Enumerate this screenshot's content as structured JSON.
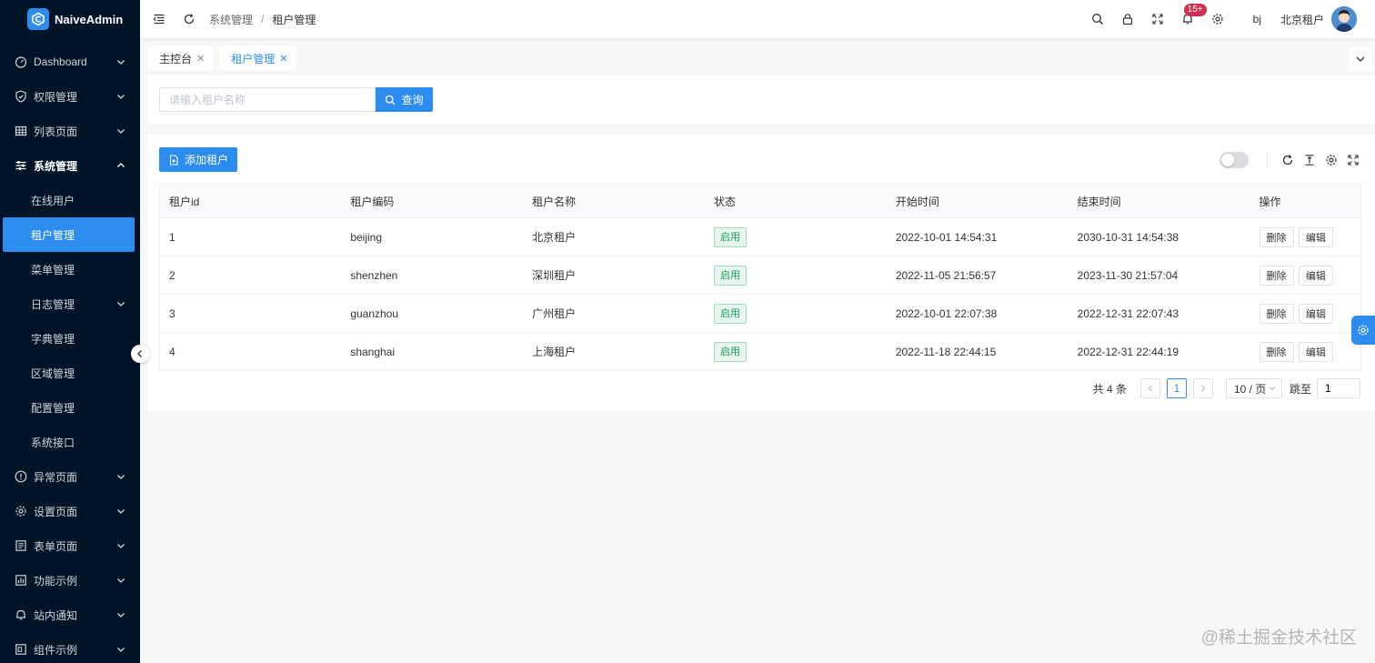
{
  "app": {
    "name": "NaiveAdmin"
  },
  "sidebar": {
    "items": [
      {
        "label": "Dashboard",
        "icon": "dashboard-icon"
      },
      {
        "label": "权限管理",
        "icon": "shield-icon"
      },
      {
        "label": "列表页面",
        "icon": "table-icon"
      },
      {
        "label": "系统管理",
        "icon": "sliders-icon",
        "open": true,
        "children": [
          {
            "label": "在线用户"
          },
          {
            "label": "租户管理",
            "active": true
          },
          {
            "label": "菜单管理"
          },
          {
            "label": "日志管理",
            "has_children": true
          },
          {
            "label": "字典管理"
          },
          {
            "label": "区域管理"
          },
          {
            "label": "配置管理"
          },
          {
            "label": "系统接口"
          }
        ]
      },
      {
        "label": "异常页面",
        "icon": "alert-icon"
      },
      {
        "label": "设置页面",
        "icon": "gear-icon"
      },
      {
        "label": "表单页面",
        "icon": "form-icon"
      },
      {
        "label": "功能示例",
        "icon": "chart-icon"
      },
      {
        "label": "站内通知",
        "icon": "bell-icon"
      },
      {
        "label": "组件示例",
        "icon": "component-icon"
      }
    ]
  },
  "header": {
    "breadcrumb": [
      "系统管理",
      "租户管理"
    ],
    "notification_badge": "15+",
    "user_short": "bj",
    "tenant_name": "北京租户"
  },
  "tabs": [
    {
      "label": "主控台"
    },
    {
      "label": "租户管理",
      "active": true
    }
  ],
  "search": {
    "placeholder": "请输入租户名称",
    "button_label": "查询"
  },
  "toolbar": {
    "add_label": "添加租户"
  },
  "table": {
    "columns": [
      "租户id",
      "租户编码",
      "租户名称",
      "状态",
      "开始时间",
      "结束时间",
      "操作"
    ],
    "rows": [
      {
        "id": "1",
        "code": "beijing",
        "name": "北京租户",
        "status": "启用",
        "start": "2022-10-01 14:54:31",
        "end": "2030-10-31 14:54:38"
      },
      {
        "id": "2",
        "code": "shenzhen",
        "name": "深圳租户",
        "status": "启用",
        "start": "2022-11-05 21:56:57",
        "end": "2023-11-30 21:57:04"
      },
      {
        "id": "3",
        "code": "guanzhou",
        "name": "广州租户",
        "status": "启用",
        "start": "2022-10-01 22:07:38",
        "end": "2022-12-31 22:07:43"
      },
      {
        "id": "4",
        "code": "shanghai",
        "name": "上海租户",
        "status": "启用",
        "start": "2022-11-18 22:44:15",
        "end": "2022-12-31 22:44:19"
      }
    ],
    "actions": {
      "delete": "删除",
      "edit": "编辑"
    }
  },
  "pagination": {
    "total_label": "共 4 条",
    "current_page": "1",
    "page_size_label": "10 / 页",
    "jump_label": "跳至",
    "jump_value": "1"
  },
  "watermark": "@稀土掘金技术社区",
  "colors": {
    "primary": "#2d8cf0",
    "sidebar_bg": "#001428",
    "success": "#18a058",
    "badge": "#d03050"
  }
}
